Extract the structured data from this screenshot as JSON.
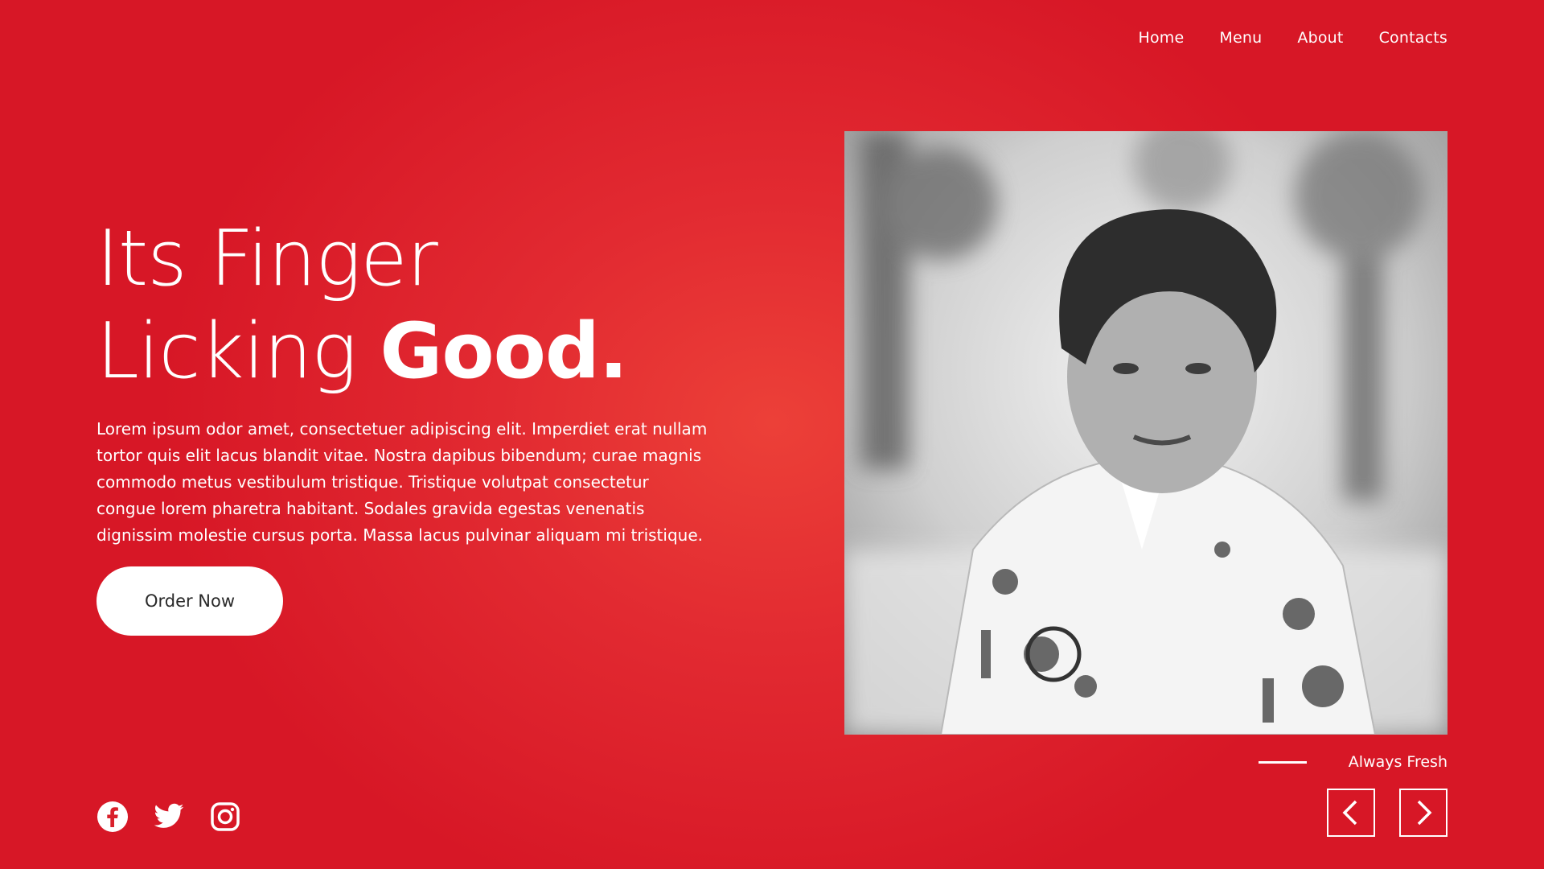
{
  "nav": {
    "items": [
      {
        "label": "Home"
      },
      {
        "label": "Menu"
      },
      {
        "label": "About"
      },
      {
        "label": "Contacts"
      }
    ]
  },
  "hero": {
    "line1": "Its Finger",
    "line2_light": "Licking ",
    "line2_bold": "Good.",
    "description": "Lorem ipsum odor amet, consectetuer adipiscing elit. Imperdiet erat nullam tortor quis elit lacus blandit vitae. Nostra dapibus bibendum; curae magnis commodo metus vestibulum tristique. Tristique volutpat consectetur congue lorem pharetra habitant. Sodales gravida egestas venenatis dignissim molestie cursus porta. Massa lacus pulvinar aliquam mi tristique.",
    "cta_label": "Order Now"
  },
  "slider": {
    "caption": "Always Fresh",
    "prev_icon": "chevron-left-icon",
    "next_icon": "chevron-right-icon"
  },
  "social": {
    "icons": [
      "facebook-icon",
      "twitter-icon",
      "instagram-icon"
    ]
  },
  "colors": {
    "background_center": "#ec4038",
    "background_edge": "#d71726",
    "button_bg": "#ffffff",
    "button_text": "#2a2a2a"
  }
}
